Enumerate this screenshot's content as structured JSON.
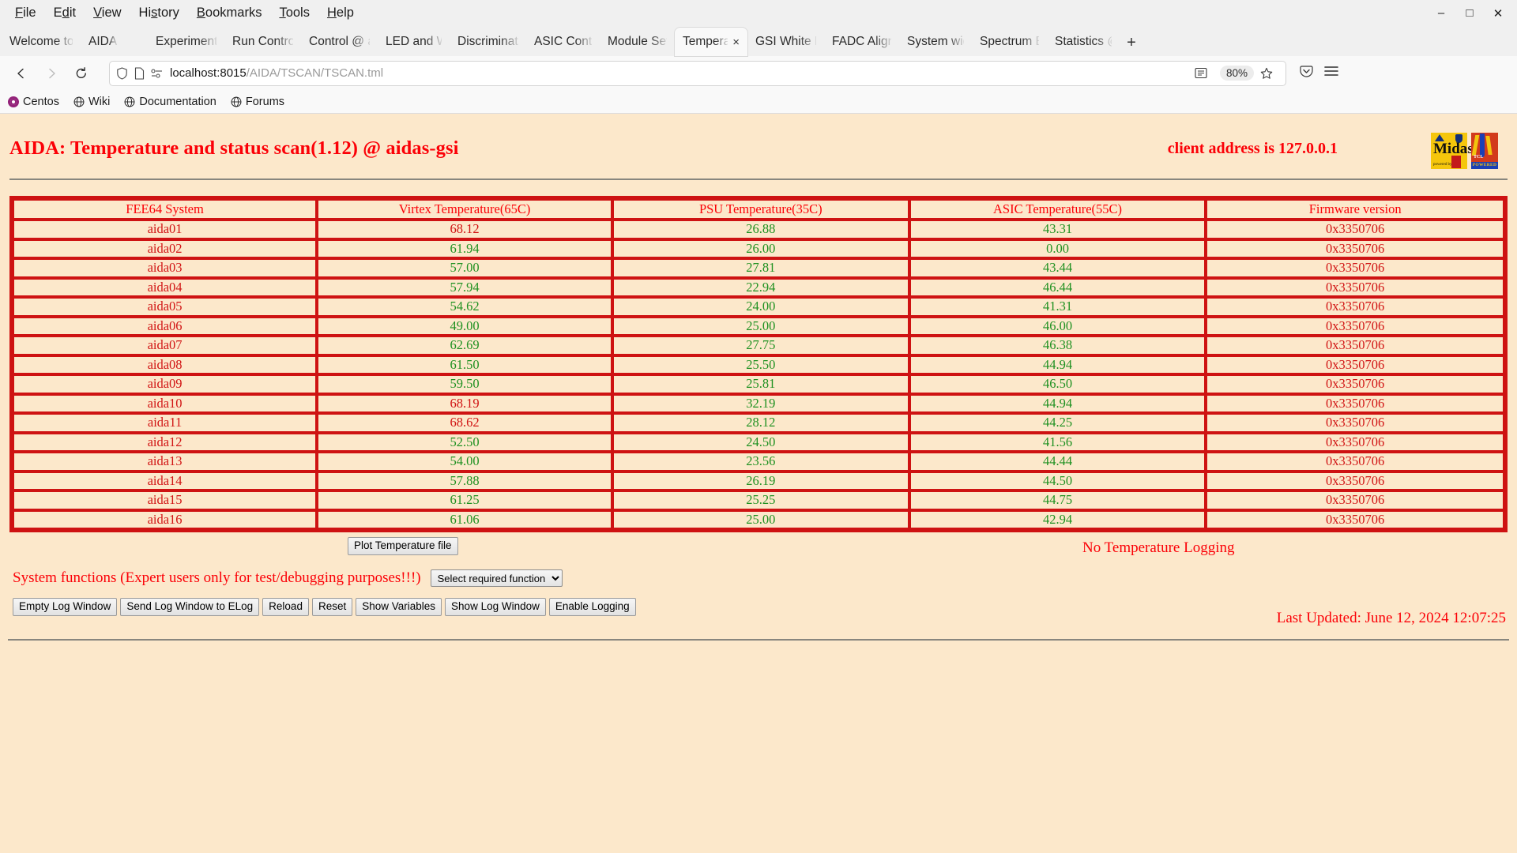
{
  "browser": {
    "menu_items": [
      "File",
      "Edit",
      "View",
      "History",
      "Bookmarks",
      "Tools",
      "Help"
    ],
    "window_controls": [
      "minimize",
      "maximize",
      "close"
    ],
    "tabs": [
      {
        "label": "Welcome to Cen",
        "active": false
      },
      {
        "label": "AIDA",
        "active": false
      },
      {
        "label": "Experiment Cont",
        "active": false
      },
      {
        "label": "Run Control @ a",
        "active": false
      },
      {
        "label": "Control @ aidas",
        "active": false
      },
      {
        "label": "LED and Wavefo",
        "active": false
      },
      {
        "label": "Discriminator co",
        "active": false
      },
      {
        "label": "ASIC Control @",
        "active": false
      },
      {
        "label": "Module Settings",
        "active": false
      },
      {
        "label": "Temperature a",
        "active": true
      },
      {
        "label": "GSI White Rabbi",
        "active": false
      },
      {
        "label": "FADC Align & Co",
        "active": false
      },
      {
        "label": "System wide Ch",
        "active": false
      },
      {
        "label": "Spectrum Brows",
        "active": false
      },
      {
        "label": "Statistics @ aida",
        "active": false
      }
    ],
    "new_tab_label": "+",
    "url_host": "localhost:8015",
    "url_path": "/AIDA/TSCAN/TSCAN.tml",
    "zoom_level": "80%",
    "bookmarks": [
      {
        "label": "Centos",
        "icon": "centos-icon"
      },
      {
        "label": "Wiki",
        "icon": "globe-icon"
      },
      {
        "label": "Documentation",
        "icon": "globe-icon"
      },
      {
        "label": "Forums",
        "icon": "globe-icon"
      }
    ]
  },
  "page": {
    "title": "AIDA: Temperature and status scan(1.12) @ aidas-gsi",
    "client_address": "client address is 127.0.0.1",
    "logos": [
      {
        "name": "midas-logo",
        "text": "Midas",
        "sub": "powered by"
      },
      {
        "name": "tcl-powered-logo",
        "text": "TCL",
        "sub": "POWERED"
      }
    ],
    "table": {
      "headers": [
        "FEE64 System",
        "Virtex Temperature(65C)",
        "PSU Temperature(35C)",
        "ASIC Temperature(55C)",
        "Firmware version"
      ],
      "rows": [
        {
          "system": "aida01",
          "virtex": "68.12",
          "virtex_state": "alarm",
          "psu": "26.88",
          "psu_state": "ok",
          "asic": "43.31",
          "asic_state": "ok",
          "firmware": "0x3350706"
        },
        {
          "system": "aida02",
          "virtex": "61.94",
          "virtex_state": "ok",
          "psu": "26.00",
          "psu_state": "ok",
          "asic": "0.00",
          "asic_state": "ok",
          "firmware": "0x3350706"
        },
        {
          "system": "aida03",
          "virtex": "57.00",
          "virtex_state": "ok",
          "psu": "27.81",
          "psu_state": "ok",
          "asic": "43.44",
          "asic_state": "ok",
          "firmware": "0x3350706"
        },
        {
          "system": "aida04",
          "virtex": "57.94",
          "virtex_state": "ok",
          "psu": "22.94",
          "psu_state": "ok",
          "asic": "46.44",
          "asic_state": "ok",
          "firmware": "0x3350706"
        },
        {
          "system": "aida05",
          "virtex": "54.62",
          "virtex_state": "ok",
          "psu": "24.00",
          "psu_state": "ok",
          "asic": "41.31",
          "asic_state": "ok",
          "firmware": "0x3350706"
        },
        {
          "system": "aida06",
          "virtex": "49.00",
          "virtex_state": "ok",
          "psu": "25.00",
          "psu_state": "ok",
          "asic": "46.00",
          "asic_state": "ok",
          "firmware": "0x3350706"
        },
        {
          "system": "aida07",
          "virtex": "62.69",
          "virtex_state": "ok",
          "psu": "27.75",
          "psu_state": "ok",
          "asic": "46.38",
          "asic_state": "ok",
          "firmware": "0x3350706"
        },
        {
          "system": "aida08",
          "virtex": "61.50",
          "virtex_state": "ok",
          "psu": "25.50",
          "psu_state": "ok",
          "asic": "44.94",
          "asic_state": "ok",
          "firmware": "0x3350706"
        },
        {
          "system": "aida09",
          "virtex": "59.50",
          "virtex_state": "ok",
          "psu": "25.81",
          "psu_state": "ok",
          "asic": "46.50",
          "asic_state": "ok",
          "firmware": "0x3350706"
        },
        {
          "system": "aida10",
          "virtex": "68.19",
          "virtex_state": "alarm",
          "psu": "32.19",
          "psu_state": "ok",
          "asic": "44.94",
          "asic_state": "ok",
          "firmware": "0x3350706"
        },
        {
          "system": "aida11",
          "virtex": "68.62",
          "virtex_state": "alarm",
          "psu": "28.12",
          "psu_state": "ok",
          "asic": "44.25",
          "asic_state": "ok",
          "firmware": "0x3350706"
        },
        {
          "system": "aida12",
          "virtex": "52.50",
          "virtex_state": "ok",
          "psu": "24.50",
          "psu_state": "ok",
          "asic": "41.56",
          "asic_state": "ok",
          "firmware": "0x3350706"
        },
        {
          "system": "aida13",
          "virtex": "54.00",
          "virtex_state": "ok",
          "psu": "23.56",
          "psu_state": "ok",
          "asic": "44.44",
          "asic_state": "ok",
          "firmware": "0x3350706"
        },
        {
          "system": "aida14",
          "virtex": "57.88",
          "virtex_state": "ok",
          "psu": "26.19",
          "psu_state": "ok",
          "asic": "44.50",
          "asic_state": "ok",
          "firmware": "0x3350706"
        },
        {
          "system": "aida15",
          "virtex": "61.25",
          "virtex_state": "ok",
          "psu": "25.25",
          "psu_state": "ok",
          "asic": "44.75",
          "asic_state": "ok",
          "firmware": "0x3350706"
        },
        {
          "system": "aida16",
          "virtex": "61.06",
          "virtex_state": "ok",
          "psu": "25.00",
          "psu_state": "ok",
          "asic": "42.94",
          "asic_state": "ok",
          "firmware": "0x3350706"
        }
      ]
    },
    "plot_button": "Plot Temperature file",
    "logging_status": "No Temperature Logging",
    "system_functions_label": "System functions (Expert users only for test/debugging purposes!!!)",
    "function_select_value": "Select required function",
    "action_buttons": [
      "Empty Log Window",
      "Send Log Window to ELog",
      "Reload",
      "Reset",
      "Show Variables",
      "Show Log Window",
      "Enable Logging"
    ],
    "last_updated": "Last Updated: June 12, 2024 12:07:25",
    "colors": {
      "background": "#FCE8CB",
      "alarm_red": "#D11414",
      "ok_green": "#1F9121",
      "heading_red": "#FB0007",
      "table_border": "#CE1212"
    }
  }
}
